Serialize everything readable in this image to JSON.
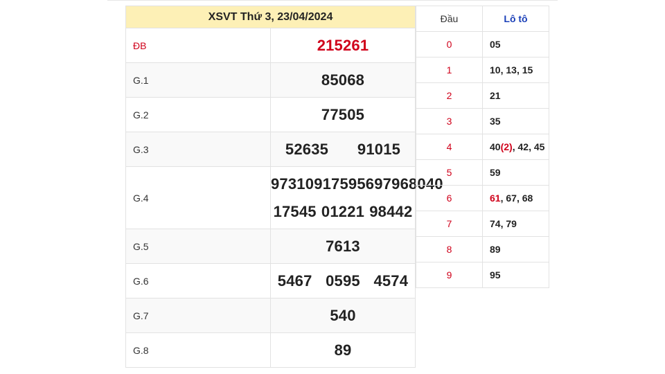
{
  "title": "XSVT Thứ 3, 23/04/2024",
  "prizes": [
    {
      "label": "ĐB",
      "values": [
        "215261"
      ]
    },
    {
      "label": "G.1",
      "values": [
        "85068"
      ]
    },
    {
      "label": "G.2",
      "values": [
        "77505"
      ]
    },
    {
      "label": "G.3",
      "values": [
        "52635",
        "91015"
      ]
    },
    {
      "label": "G.4",
      "values": [
        "97310",
        "91759",
        "56979",
        "68040",
        "17545",
        "01221",
        "98442"
      ]
    },
    {
      "label": "G.5",
      "values": [
        "7613"
      ]
    },
    {
      "label": "G.6",
      "values": [
        "5467",
        "0595",
        "4574"
      ]
    },
    {
      "label": "G.7",
      "values": [
        "540"
      ]
    },
    {
      "label": "G.8",
      "values": [
        "89"
      ]
    }
  ],
  "loto": {
    "header_dau": "Đầu",
    "header_loto": "Lô tô",
    "rows": [
      {
        "dau": "0",
        "items": [
          {
            "t": "05"
          }
        ]
      },
      {
        "dau": "1",
        "items": [
          {
            "t": "10"
          },
          {
            "t": "13"
          },
          {
            "t": "15"
          }
        ]
      },
      {
        "dau": "2",
        "items": [
          {
            "t": "21"
          }
        ]
      },
      {
        "dau": "3",
        "items": [
          {
            "t": "35"
          }
        ]
      },
      {
        "dau": "4",
        "items": [
          {
            "t": "40",
            "count": "(2)"
          },
          {
            "t": "42"
          },
          {
            "t": "45"
          }
        ]
      },
      {
        "dau": "5",
        "items": [
          {
            "t": "59"
          }
        ]
      },
      {
        "dau": "6",
        "items": [
          {
            "t": "61",
            "red": true
          },
          {
            "t": "67"
          },
          {
            "t": "68"
          }
        ]
      },
      {
        "dau": "7",
        "items": [
          {
            "t": "74"
          },
          {
            "t": "79"
          }
        ]
      },
      {
        "dau": "8",
        "items": [
          {
            "t": "89"
          }
        ]
      },
      {
        "dau": "9",
        "items": [
          {
            "t": "95"
          }
        ]
      }
    ]
  },
  "colors": {
    "accent_red": "#d0021b",
    "header_bg": "#fdf0b6",
    "loto_header": "#1a3fb8"
  }
}
